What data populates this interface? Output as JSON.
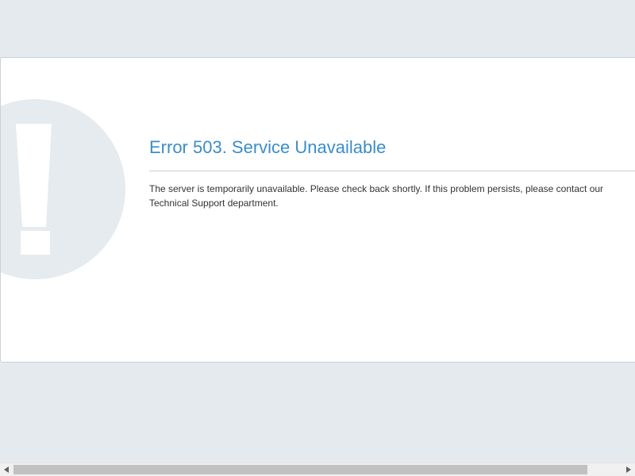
{
  "error": {
    "title": "Error 503. Service Unavailable",
    "message": "The server is temporarily unavailable. Please check back shortly. If this problem persists, please contact our Technical Support department.",
    "icon": "exclamation-icon"
  },
  "colors": {
    "background": "#e5eaee",
    "card": "#ffffff",
    "title": "#3a8dcb",
    "icon_circle": "#e5ebef",
    "text": "#333333"
  },
  "scrollbar": {
    "orientation": "horizontal",
    "left_arrow_icon": "triangle-left-icon",
    "right_arrow_icon": "triangle-right-icon"
  }
}
